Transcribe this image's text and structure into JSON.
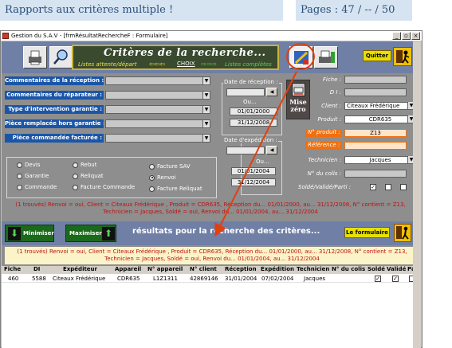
{
  "doc": {
    "title": "Rapports aux critères multiple !",
    "pages": "Pages : 47 / -- / 50"
  },
  "window": {
    "title": "Gestion du S.A.V - [frmRésultatRechercheF : Formulaire]",
    "ctrl_min": "_",
    "ctrl_max": "▫",
    "ctrl_close": "×"
  },
  "banner": {
    "title": "Critères de la recherche...",
    "sub_left": "Listes attente/départ",
    "arrows_left": "⇦⇦⇦",
    "choix": "CHOIX",
    "arrows_right": "⇨⇨⇨",
    "sub_right": "Listes complètes"
  },
  "buttons": {
    "quitter": "Quitter",
    "mise_zero": "Mise zéro",
    "minimiser": "Minimiser",
    "maximiser": "Maximiser",
    "formulaire": "Le formulaire"
  },
  "criteria": [
    {
      "label": "Commentaires de la réception :"
    },
    {
      "label": "Commentaires du réparateur :"
    },
    {
      "label": "Type d'intervention garantie :"
    },
    {
      "label": "Pièce remplacée hors garantie :"
    },
    {
      "label": "Pièce commandée facturée :"
    }
  ],
  "radios": {
    "devis": "Devis",
    "garantie": "Garantie",
    "commande": "Commande",
    "rebut": "Rebut",
    "reliquat": "Reliquat",
    "facture_commande": "Facture Commande",
    "facture_sav": "Facture SAV",
    "renvoi": "Renvoi",
    "facture_reliquat": "Facture Reliquat",
    "selected": "renvoi"
  },
  "dates": {
    "reception_label": "Date de réception :",
    "ou": "Ou...",
    "reception_from": "01/01/2000",
    "reception_to": "31/12/2008",
    "expedition_label": "Date d'expédition :",
    "ou2": "Ou...",
    "expedition_from": "01/01/2004",
    "expedition_to": "31/12/2004",
    "step": "◀"
  },
  "fields": {
    "fiche_label": "Fiche :",
    "di_label": "D I :",
    "client_label": "Client :",
    "client_value": "Citeaux  Frédérique",
    "produit_label": "Produit :",
    "produit_value": "CDR635",
    "num_produit_label": "N° produit :",
    "num_produit_value": "Z13",
    "reference_label": "Référence :",
    "technicien_label": "Technicien :",
    "technicien_value": "Jacques",
    "colis_label": "N° du colis :",
    "solde_label": "Soldé/Validé/Parti :",
    "check_mark": "✓"
  },
  "summary_top": "(1 trouvés)  Renvoi = oui, Client = Citeaux  Frédérique , Produit = CDR635, Réception du... 01/01/2000, au... 31/12/2008, N° contient = Z13, Technicien = Jacques, Soldé = oui, Renvoi du... 01/01/2004, au... 31/12/2004",
  "results_title": "résultats pour la recherche des critères...",
  "summary_bottom": "(1 trouvés)  Renvoi = oui, Client = Citeaux  Frédérique , Produit = CDR635, Réception du... 01/01/2000, au... 31/12/2008, N° contient = Z13, Technicien = Jacques, Soldé = oui, Renvoi du... 01/01/2004, au... 31/12/2004",
  "table": {
    "headers": [
      "Fiche",
      "DI",
      "Expéditeur",
      "Appareil",
      "N° appareil",
      "N° client",
      "Réception",
      "Expédition",
      "Technicien",
      "N° du colis",
      "Soldé",
      "Validé",
      "Pa"
    ],
    "row": {
      "fiche": "460",
      "di": "5588",
      "expediteur": "Citeaux    Frédérique",
      "appareil": "CDR635",
      "num_appareil": "L1Z1311",
      "num_client": "42869146",
      "reception": "31/01/2004",
      "expedition": "07/02/2004",
      "technicien": "Jacques",
      "colis": ""
    }
  },
  "colors": {
    "accent_blue": "#1a56a8",
    "band": "#6f7fa5",
    "annotation": "#e04010",
    "summary_red": "#c01010"
  },
  "icons": [
    "printer-icon",
    "magnifier-icon",
    "search-criteria-icon",
    "print-preview-icon",
    "exit-runner-icon",
    "arrow-down-icon",
    "arrow-up-icon",
    "eraser-icon"
  ]
}
